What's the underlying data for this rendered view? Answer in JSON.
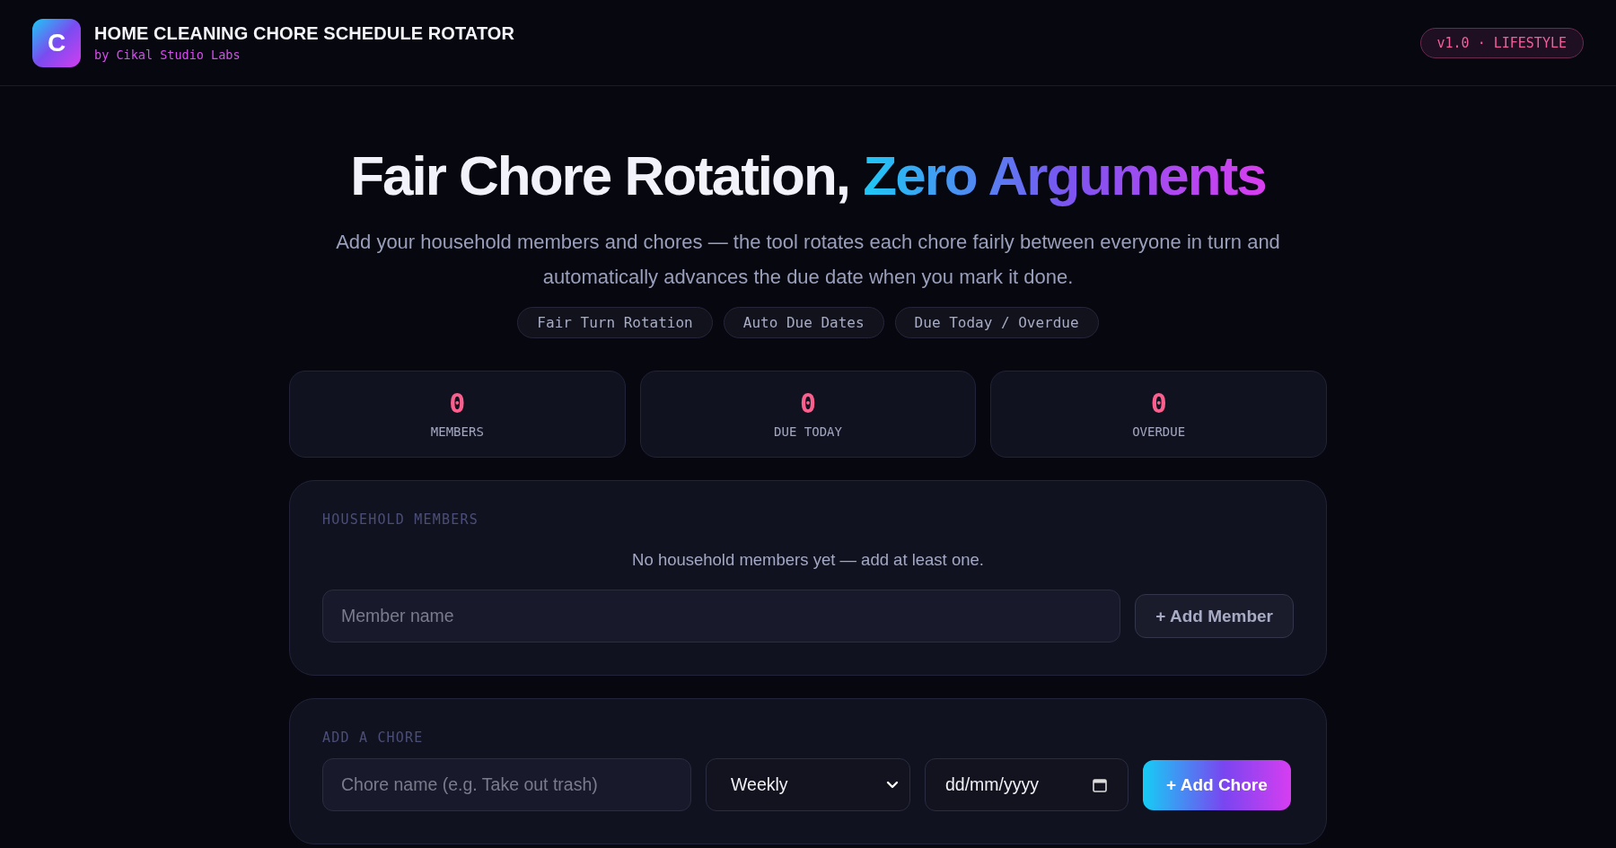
{
  "header": {
    "logo_letter": "C",
    "title": "HOME CLEANING CHORE SCHEDULE ROTATOR",
    "byline": "by Cikal Studio Labs",
    "badge": "v1.0 · LIFESTYLE"
  },
  "hero": {
    "title": "Fair Chore Rotation,",
    "highlight": "Zero Arguments",
    "subtitle": "Add your household members and chores — the tool rotates each chore fairly between everyone in turn and automatically advances the due date when you mark it done.",
    "chips": [
      "Fair Turn Rotation",
      "Auto Due Dates",
      "Due Today / Overdue"
    ]
  },
  "stats": [
    {
      "value": "0",
      "label": "MEMBERS"
    },
    {
      "value": "0",
      "label": "DUE TODAY"
    },
    {
      "value": "0",
      "label": "OVERDUE"
    }
  ],
  "members": {
    "heading": "HOUSEHOLD MEMBERS",
    "empty": "No household members yet — add at least one.",
    "input": {
      "placeholder": "Member name"
    },
    "button": "+ Add Member"
  },
  "chore": {
    "heading": "ADD A CHORE",
    "name": {
      "placeholder": "Chore name (e.g. Take out trash)"
    },
    "frequency": {
      "value": "Weekly"
    },
    "date": {
      "placeholder": "dd/mm/yyyy"
    },
    "button": "+ Add Chore"
  }
}
